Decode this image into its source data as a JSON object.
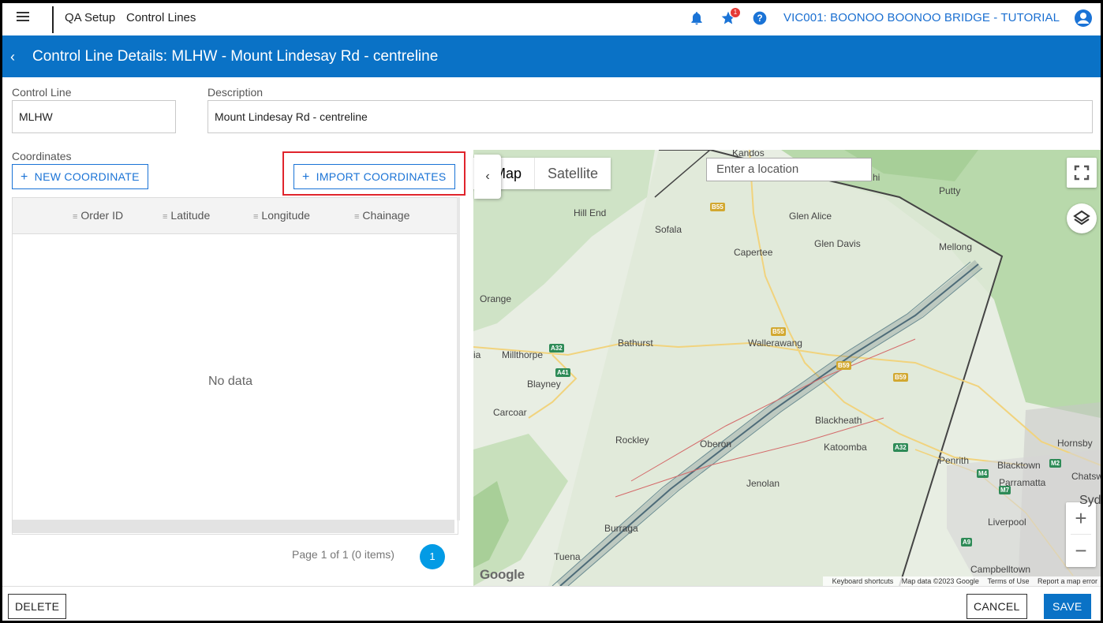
{
  "topbar": {
    "breadcrumb_1": "QA Setup",
    "breadcrumb_2": "Control Lines",
    "notification_badge": "1",
    "project": "VIC001: BOONOO BOONOO BRIDGE - TUTORIAL"
  },
  "header": {
    "title": "Control Line Details: MLHW - Mount Lindesay Rd - centreline"
  },
  "form": {
    "control_line_label": "Control Line",
    "control_line_value": "MLHW",
    "description_label": "Description",
    "description_value": "Mount Lindesay Rd - centreline"
  },
  "coordinates": {
    "section_label": "Coordinates",
    "new_button": "NEW COORDINATE",
    "import_button": "IMPORT COORDINATES",
    "columns": [
      "Order ID",
      "Latitude",
      "Longitude",
      "Chainage"
    ],
    "empty_text": "No data",
    "pager_text": "Page 1 of 1 (0 items)",
    "current_page": "1"
  },
  "map": {
    "tab_map": "Map",
    "tab_satellite": "Satellite",
    "search_placeholder": "Enter a location",
    "places": {
      "kandos": "Kandos",
      "putty": "Putty",
      "hill_end": "Hill End",
      "sofala": "Sofala",
      "glen_alice": "Glen Alice",
      "glen_davis": "Glen Davis",
      "capertee": "Capertee",
      "mellong": "Mellong",
      "orange": "Orange",
      "bathurst": "Bathurst",
      "wallerawang": "Wallerawang",
      "millthorpe": "Millthorpe",
      "blayney": "Blayney",
      "carcoar": "Carcoar",
      "blackheath": "Blackheath",
      "rockley": "Rockley",
      "oberon": "Oberon",
      "katoomba": "Katoomba",
      "penrith": "Penrith",
      "blacktown": "Blacktown",
      "hornsby": "Hornsby",
      "parramatta": "Parramatta",
      "chatsw": "Chatsw",
      "syd": "Syd",
      "jenolan": "Jenolan",
      "burraga": "Burraga",
      "liverpool": "Liverpool",
      "tuena": "Tuena",
      "campbelltown": "Campbelltown",
      "ia": "ia",
      "hi": "hi"
    },
    "shields": {
      "b55a": "B55",
      "b55b": "B55",
      "b59a": "B59",
      "b59b": "B59",
      "a32a": "A32",
      "a32b": "A32",
      "a41": "A41",
      "m4": "M4",
      "m2": "M2",
      "m7": "M7",
      "a9": "A9"
    },
    "google": "Google",
    "attribution": {
      "shortcuts": "Keyboard shortcuts",
      "data": "Map data ©2023 Google",
      "terms": "Terms of Use",
      "report": "Report a map error"
    }
  },
  "footer": {
    "delete": "DELETE",
    "cancel": "CANCEL",
    "save": "SAVE"
  }
}
